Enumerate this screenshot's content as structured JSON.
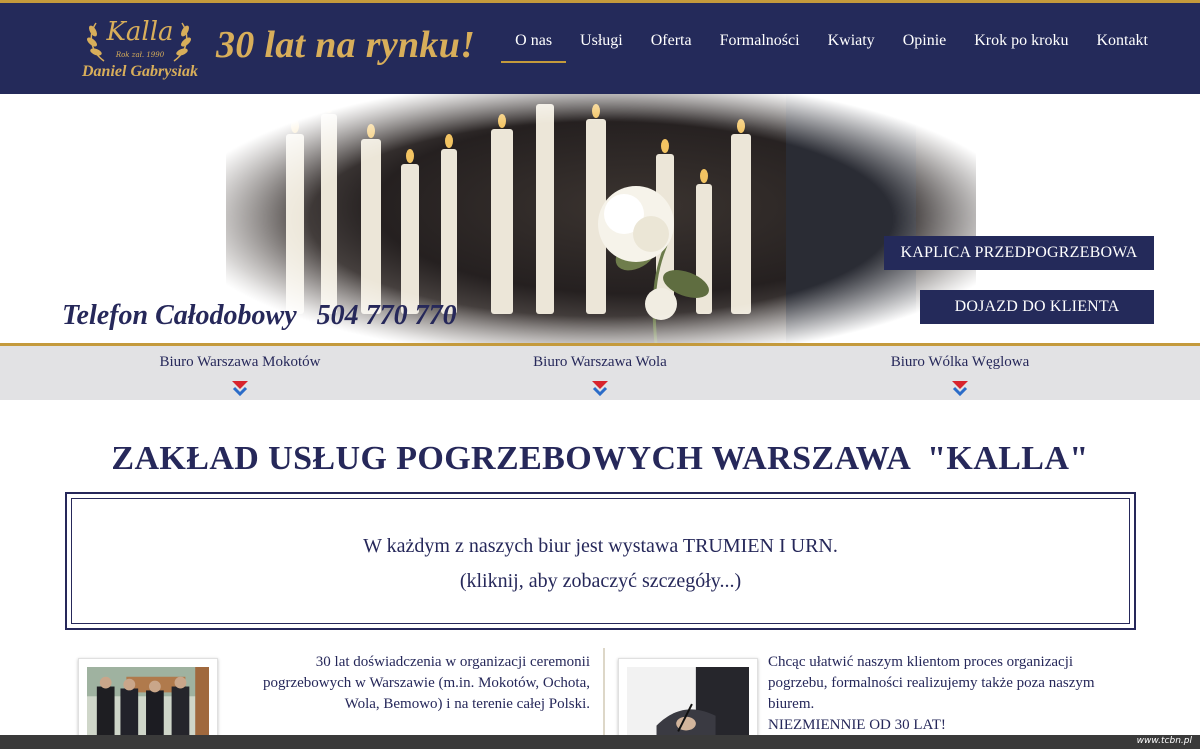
{
  "header": {
    "logo": {
      "brand": "Kalla",
      "est": "Rok zał. 1990",
      "owner": "Daniel Gabrysiak"
    },
    "slogan": "30 lat na rynku!",
    "nav": [
      {
        "label": "O nas",
        "active": true
      },
      {
        "label": "Usługi"
      },
      {
        "label": "Oferta"
      },
      {
        "label": "Formalności"
      },
      {
        "label": "Kwiaty"
      },
      {
        "label": "Opinie"
      },
      {
        "label": "Krok po kroku"
      },
      {
        "label": "Kontakt"
      }
    ]
  },
  "hero": {
    "phone_label": "Telefon Całodobowy",
    "phone_number": "504 770 770",
    "chapel_button": "KAPLICA PRZEDPOGRZEBOWA",
    "visit_button": "DOJAZD DO KLIENTA"
  },
  "offices": [
    {
      "label": "Biuro Warszawa Mokotów"
    },
    {
      "label": "Biuro Warszawa Wola"
    },
    {
      "label": "Biuro Wólka Węglowa"
    }
  ],
  "main": {
    "title": "ZAKŁAD USŁUG POGRZEBOWYCH WARSZAWA  \"KALLA\"",
    "notice_line1": "W każdym z naszych biur jest wystawa TRUMIEN I URN.",
    "notice_line2": "(kliknij, aby zobaczyć szczegóły...)",
    "left_text": "30 lat doświadczenia w organizacji ceremonii pogrzebowych w Warszawie (m.in. Mokotów, Ochota, Wola, Bemowo) i na terenie całej Polski.",
    "right_text": "Chcąc ułatwić naszym klientom proces organizacji pogrzebu, formalności realizujemy także poza naszym biurem.",
    "right_strong": "NIEZMIENNIE OD 30 LAT!"
  },
  "footer": {
    "credit": "www.tcbn.pl"
  },
  "colors": {
    "navy": "#242a5a",
    "gold": "#c49a3c",
    "strip": "#e2e2e4"
  }
}
